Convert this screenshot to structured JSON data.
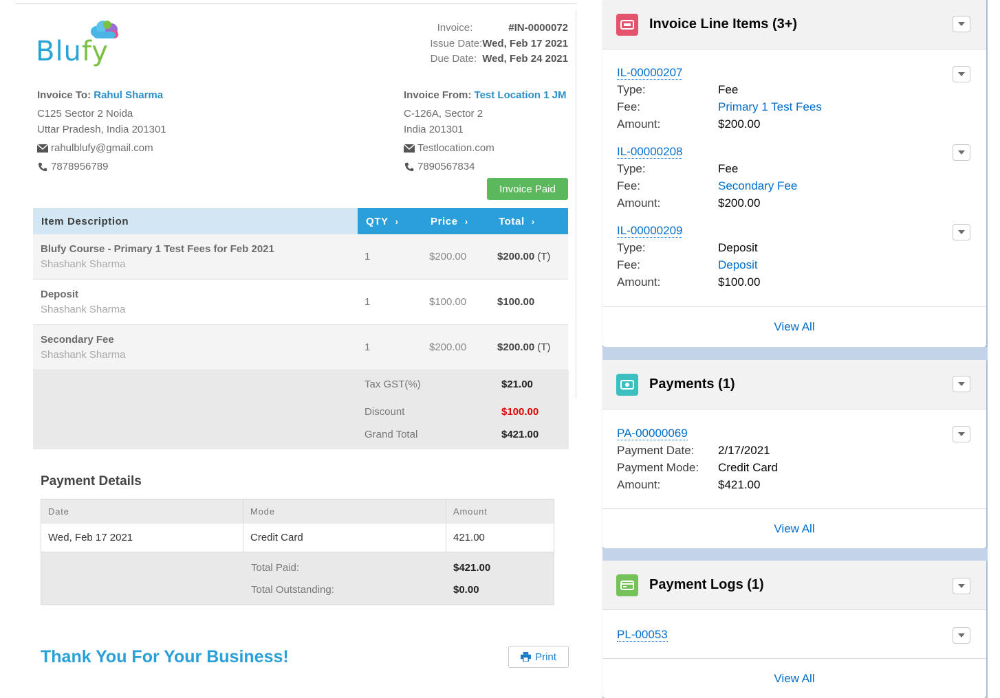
{
  "invoice": {
    "brand": {
      "name_blue": "Blu",
      "name_green": "fy"
    },
    "meta": [
      {
        "label": "Invoice:",
        "value": "#IN-0000072"
      },
      {
        "label": "Issue Date:",
        "value": "Wed, Feb 17 2021"
      },
      {
        "label": "Due Date:",
        "value": "Wed, Feb 24 2021"
      }
    ],
    "to": {
      "label": "Invoice To:",
      "name": "Rahul Sharma",
      "address1": "C125 Sector 2  Noida",
      "address2": "Uttar Pradesh, India 201301",
      "email": "rahulblufy@gmail.com",
      "phone": "7878956789"
    },
    "from": {
      "label": "Invoice From:",
      "name": "Test Location 1 JM",
      "address1": "C-126A, Sector 2",
      "address2": "India 201301",
      "email": "Testlocation.com",
      "phone": "7890567834"
    },
    "status_button": "Invoice Paid",
    "table_headers": {
      "description": "Item Description",
      "qty": "QTY",
      "price": "Price",
      "total": "Total"
    },
    "items": [
      {
        "title": "Blufy Course - Primary 1 Test Fees for Feb 2021",
        "sub": "Shashank Sharma",
        "qty": "1",
        "price": "$200.00",
        "total": "$200.00",
        "tax_flag": "(T)"
      },
      {
        "title": "Deposit",
        "sub": "Shashank Sharma",
        "qty": "1",
        "price": "$100.00",
        "total": "$100.00",
        "tax_flag": ""
      },
      {
        "title": "Secondary Fee",
        "sub": "Shashank Sharma",
        "qty": "1",
        "price": "$200.00",
        "total": "$200.00",
        "tax_flag": "(T)"
      }
    ],
    "totals": [
      {
        "label": "Tax GST(%)",
        "value": "$21.00"
      },
      {
        "label": "Discount",
        "value": "$100.00"
      },
      {
        "label": "Grand Total",
        "value": "$421.00"
      }
    ],
    "payment_details": {
      "title": "Payment Details",
      "headers": [
        "Date",
        "Mode",
        "Amount"
      ],
      "rows": [
        {
          "date": "Wed, Feb 17 2021",
          "mode": "Credit Card",
          "amount": "421.00"
        }
      ],
      "total_paid_label": "Total Paid:",
      "total_paid": "$421.00",
      "total_outstanding_label": "Total Outstanding:",
      "total_outstanding": "$0.00"
    },
    "thanks": "Thank You For Your Business!",
    "print_button": "Print",
    "colors": {
      "accent_blue": "#2b9fda",
      "paid_green": "#5cb85c",
      "discount_red": "#e00000"
    }
  },
  "sidebar": {
    "line_items": {
      "title": "Invoice Line Items (3+)",
      "icon": "ticket-icon",
      "icon_color": "#e3546c",
      "records": [
        {
          "id": "IL-00000207",
          "type_label": "Type:",
          "type": "Fee",
          "fee_label": "Fee:",
          "fee": "Primary 1 Test Fees",
          "amount_label": "Amount:",
          "amount": "$200.00"
        },
        {
          "id": "IL-00000208",
          "type_label": "Type:",
          "type": "Fee",
          "fee_label": "Fee:",
          "fee": "Secondary Fee",
          "amount_label": "Amount:",
          "amount": "$200.00"
        },
        {
          "id": "IL-00000209",
          "type_label": "Type:",
          "type": "Deposit",
          "fee_label": "Fee:",
          "fee": "Deposit",
          "amount_label": "Amount:",
          "amount": "$100.00"
        }
      ],
      "view_all": "View All"
    },
    "payments": {
      "title": "Payments (1)",
      "icon": "money-icon",
      "icon_color": "#3bbfbf",
      "records": [
        {
          "id": "PA-00000069",
          "date_label": "Payment Date:",
          "date": "2/17/2021",
          "mode_label": "Payment Mode:",
          "mode": "Credit Card",
          "amount_label": "Amount:",
          "amount": "$421.00"
        }
      ],
      "view_all": "View All"
    },
    "payment_logs": {
      "title": "Payment Logs (1)",
      "icon": "card-icon",
      "icon_color": "#76c25a",
      "records": [
        {
          "id": "PL-00053"
        }
      ],
      "view_all": "View All"
    }
  }
}
